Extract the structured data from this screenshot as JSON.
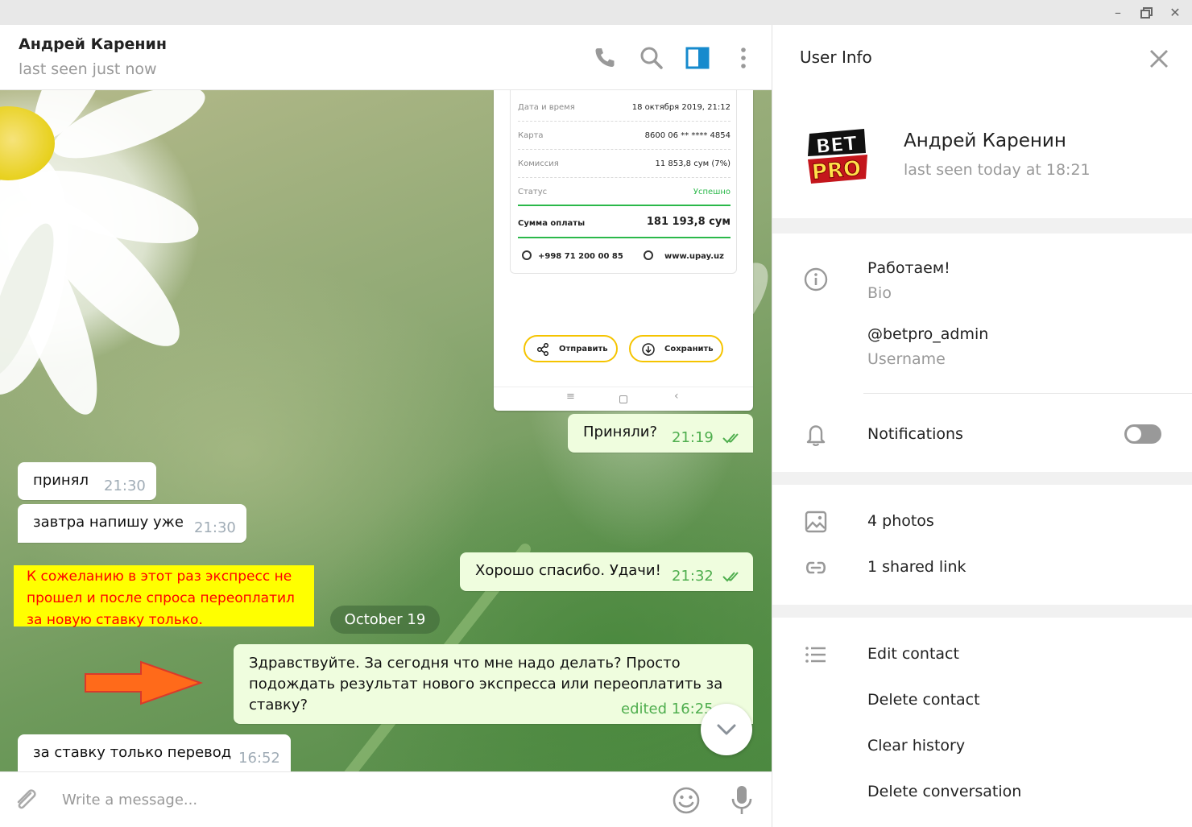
{
  "chat": {
    "name": "Андрей Каренин",
    "status": "last seen just now"
  },
  "receipt": {
    "rows": [
      {
        "label": "Дата и время",
        "value": "18 октября 2019, 21:12"
      },
      {
        "label": "Карта",
        "value": "8600 06 ** **** 4854"
      },
      {
        "label": "Комиссия",
        "value": "11 853,8 сум (7%)"
      },
      {
        "label": "Статус",
        "value": "Успешно"
      }
    ],
    "total_label": "Сумма оплаты",
    "total_value": "181 193,8 сум",
    "phone": "+998 71 200 00 85",
    "site": "www.upay.uz",
    "send_label": "Отправить",
    "save_label": "Сохранить",
    "status_color": "#2bb84a",
    "button_border_color": "#f5c400"
  },
  "messages": [
    {
      "text": "Приняли?",
      "time": "21:19"
    },
    {
      "text": "принял",
      "time": "21:30"
    },
    {
      "text": "завтра напишу уже",
      "time": "21:30"
    },
    {
      "text": "Хорошо спасибо. Удачи!",
      "time": "21:32"
    },
    {
      "text": "Здравствуйте. За сегодня что мне надо делать? Просто подождать результат нового экспресса или переоплатить за ставку?",
      "time": "edited 16:25"
    },
    {
      "text": "за ставку только перевод",
      "time": "16:52"
    }
  ],
  "annotation": {
    "lines": [
      "К сожеланию в этот раз экспресс не",
      "прошел и после спроса переоплатил",
      "за новую ставку только."
    ]
  },
  "date_divider": "October 19",
  "input": {
    "placeholder": "Write a message..."
  },
  "info": {
    "title": "User Info",
    "name": "Андрей Каренин",
    "last_seen": "last seen today at 18:21",
    "avatar_text_top": "BET",
    "avatar_text_bottom": "PRO",
    "bio": "Работаем!",
    "bio_label": "Bio",
    "username": "@betpro_admin",
    "username_label": "Username",
    "notifications_label": "Notifications",
    "notifications_on": false,
    "photos": "4 photos",
    "links": "1 shared link",
    "actions": [
      "Edit contact",
      "Delete contact",
      "Clear history",
      "Delete conversation"
    ]
  },
  "colors": {
    "accent": "#168acd",
    "outgoing_bubble": "#effdde",
    "outgoing_time": "#4fae4e",
    "annotation_bg": "#ffff00",
    "annotation_text": "#ff0000",
    "arrow": "#ff6a1a"
  },
  "icons": [
    "phone-icon",
    "search-icon",
    "sidebar-toggle-icon",
    "more-icon",
    "close-icon",
    "info-icon",
    "bell-icon",
    "photo-icon",
    "link-icon",
    "list-icon",
    "attach-icon",
    "emoji-icon",
    "mic-icon",
    "chevron-down-icon"
  ]
}
